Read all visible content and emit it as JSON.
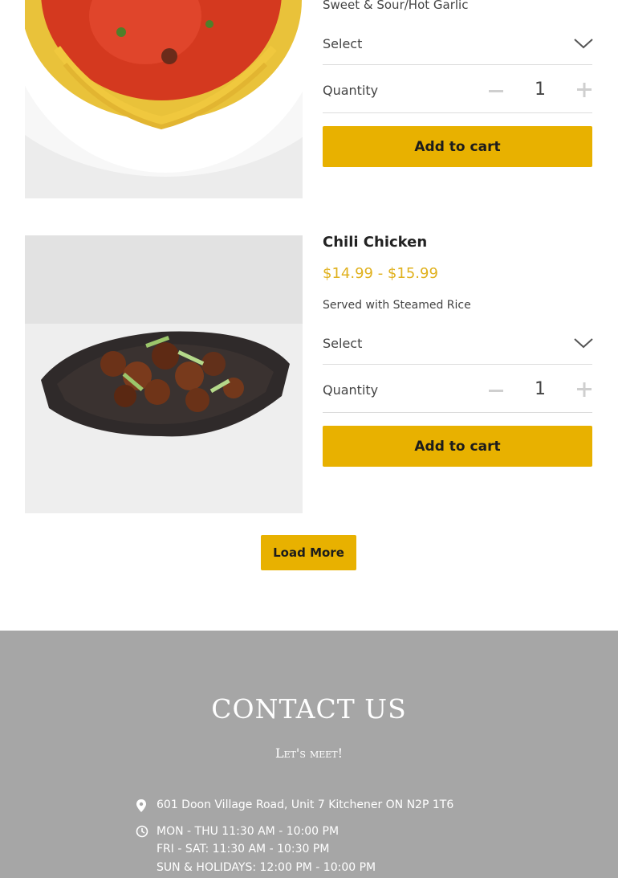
{
  "colors": {
    "accent": "#e8b100",
    "price": "#e0b11e",
    "footer_bg": "#a6a6a6"
  },
  "products": [
    {
      "name": "",
      "price": "",
      "description": "Sweet & Sour/Hot Garlic",
      "image_icon": "noodles-dish-image",
      "select_label": "Select",
      "quantity_label": "Quantity",
      "quantity": "1",
      "add_to_cart": "Add to cart"
    },
    {
      "name": "Chili Chicken",
      "price": "$14.99 - $15.99",
      "description": "Served with Steamed Rice",
      "image_icon": "chili-chicken-dish-image",
      "select_label": "Select",
      "quantity_label": "Quantity",
      "quantity": "1",
      "add_to_cart": "Add to cart"
    }
  ],
  "load_more": "Load More",
  "contact": {
    "title": "CONTACT US",
    "subtitle": "Let's meet!",
    "address_icon": "map-pin-icon",
    "address": "601 Doon Village Road, Unit 7 Kitchener ON N2P 1T6",
    "hours_icon": "clock-icon",
    "hours": [
      "MON - THU 11:30 AM - 10:00 PM",
      "FRI - SAT: 11:30 AM - 10:30 PM",
      "SUN & HOLIDAYS: 12:00 PM - 10:00 PM"
    ]
  }
}
